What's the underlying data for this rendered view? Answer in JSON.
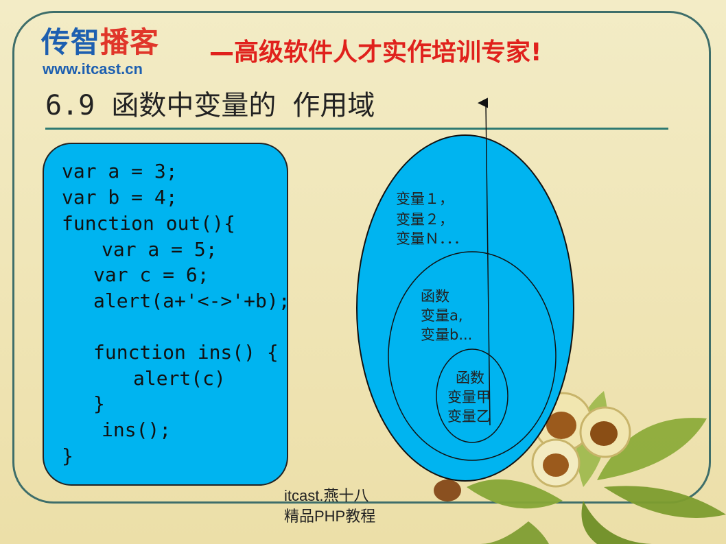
{
  "logo": {
    "name_prefix": "传智",
    "name_suffix": "播客",
    "url": "www.itcast.cn"
  },
  "slogan": "—高级软件人才实作培训专家!",
  "title": "6.9 函数中变量的 作用域",
  "code": [
    "var a = 3;",
    "var b = 4;",
    "function out(){",
    "var a = 5;",
    "var c = 6;",
    "alert(a+'<->'+b);",
    "function ins() {",
    "alert(c)",
    "}",
    "ins();",
    "}"
  ],
  "scope_diagram": {
    "outer": [
      "变量１，",
      "变量２，",
      "变量Ｎ．．．"
    ],
    "middle": [
      "函数",
      "变量a,",
      "变量b..."
    ],
    "inner": [
      "函数",
      "变量甲",
      "变量乙"
    ]
  },
  "footer": {
    "line1": "itcast.燕十八",
    "line2": "精品PHP教程"
  },
  "colors": {
    "code_bg": "#00b4f0",
    "frame": "#3e6e6a",
    "slogan": "#e0211c"
  }
}
